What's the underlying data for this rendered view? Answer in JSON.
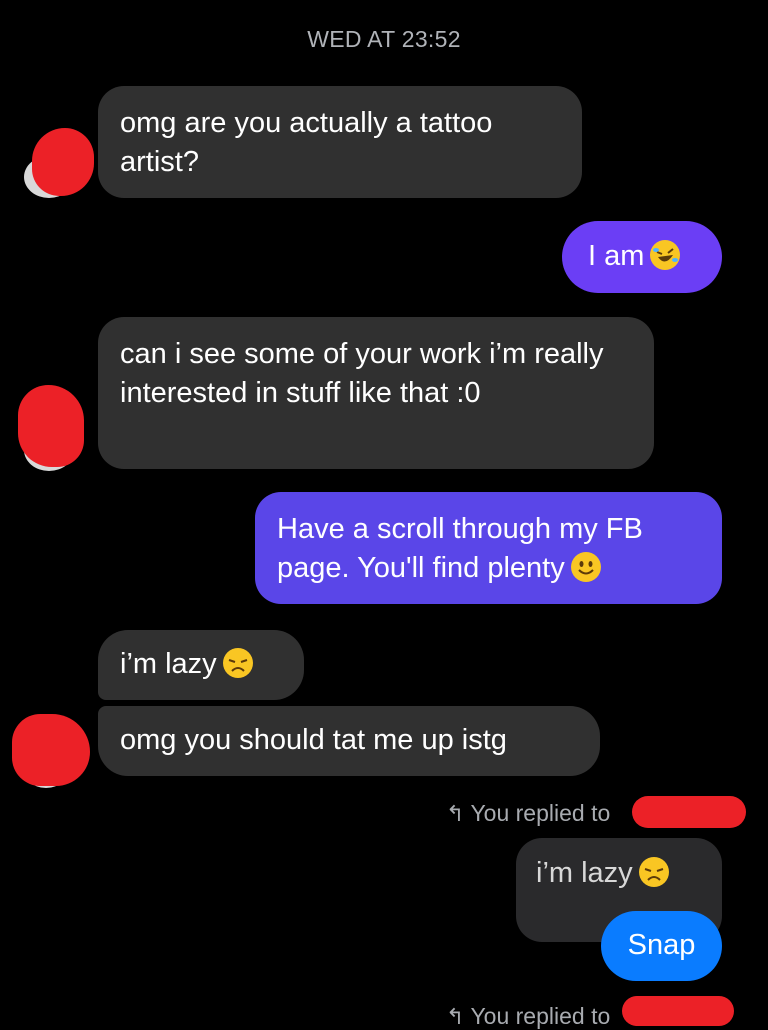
{
  "conversation": {
    "timestamp": "WED AT 23:52",
    "messages": [
      {
        "text": "omg are you actually a tattoo artist?",
        "sender": "other"
      },
      {
        "text": "I am",
        "sender": "me",
        "emoji": "rofl-emoji"
      },
      {
        "text": "can i see some of your work i’m really interested in stuff like that :0",
        "sender": "other"
      },
      {
        "text": "Have a scroll through my FB page. You'll find plenty",
        "sender": "me",
        "emoji": "smile-emoji"
      },
      {
        "text": "i’m lazy",
        "sender": "other",
        "emoji": "disappointed-emoji"
      },
      {
        "text": "omg you should tat me up istg",
        "sender": "other"
      }
    ],
    "reply_1": {
      "label": "You replied to",
      "quoted_text": "i’m lazy",
      "quoted_emoji": "disappointed-emoji",
      "message": "Snap"
    },
    "reply_2": {
      "label": "You replied to"
    }
  },
  "colors": {
    "incoming": "#303030",
    "outgoing_purple": "#6b3ef5",
    "outgoing_indigo": "#5a46e8",
    "outgoing_blue": "#0a7cff",
    "redaction": "#ec2127"
  }
}
